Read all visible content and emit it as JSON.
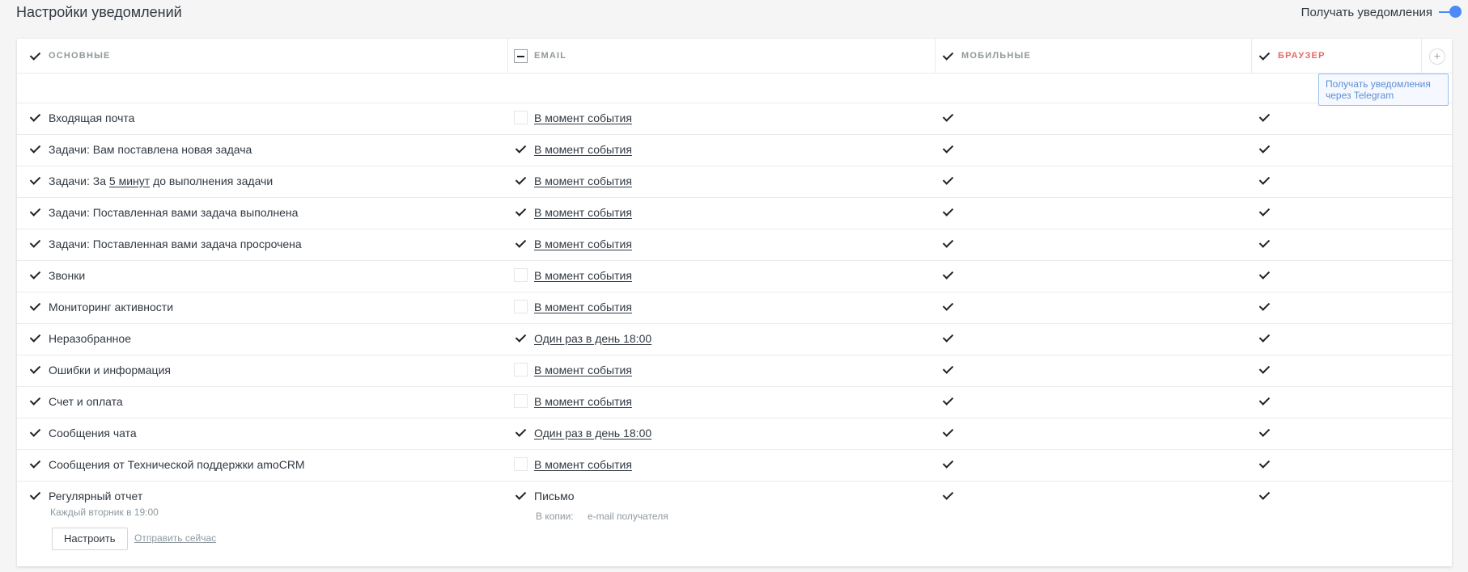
{
  "page": {
    "title": "Настройки уведомлений",
    "receive_label": "Получать уведомления"
  },
  "columns": [
    {
      "label": "ОСНОВНЫЕ",
      "state": "checked"
    },
    {
      "label": "EMAIL",
      "state": "partial"
    },
    {
      "label": "МОБИЛЬНЫЕ",
      "state": "checked"
    },
    {
      "label": "БРАУЗЕР",
      "state": "checked",
      "color": "#e36a6a"
    }
  ],
  "add_column_label": "+",
  "tooltip": "Получать уведомления через Telegram",
  "rows": [
    {
      "name": "Входящая почта",
      "email_checked": false,
      "email_text": "В момент события"
    },
    {
      "name": "Задачи: Вам поставлена новая задача",
      "email_checked": true,
      "email_text": "В момент события"
    },
    {
      "name_pre": "Задачи: За ",
      "name_link": "5 минут",
      "name_post": " до выполнения задачи",
      "email_checked": true,
      "email_text": "В момент события"
    },
    {
      "name": "Задачи: Поставленная вами задача выполнена",
      "email_checked": true,
      "email_text": "В момент события"
    },
    {
      "name": "Задачи: Поставленная вами задача просрочена",
      "email_checked": true,
      "email_text": "В момент события"
    },
    {
      "name": "Звонки",
      "email_checked": false,
      "email_text": "В момент события"
    },
    {
      "name": "Мониторинг активности",
      "email_checked": false,
      "email_text": "В момент события"
    },
    {
      "name": "Неразобранное",
      "email_checked": true,
      "email_text": "Один раз в день 18:00"
    },
    {
      "name": "Ошибки и информация",
      "email_checked": false,
      "email_text": "В момент события"
    },
    {
      "name": "Счет и оплата",
      "email_checked": false,
      "email_text": "В момент события"
    },
    {
      "name": "Сообщения чата",
      "email_checked": true,
      "email_text": "Один раз в день 18:00"
    },
    {
      "name": "Сообщения от Технической поддержки amoCRM",
      "email_checked": false,
      "email_text": "В момент события"
    }
  ],
  "report": {
    "name": "Регулярный отчет",
    "schedule": "Каждый вторник в 19:00",
    "email_text": "Письмо",
    "copies_label": "В копии:",
    "copies_placeholder": "e-mail получателя",
    "setup_button": "Настроить",
    "send_now": "Отправить сейчас"
  }
}
